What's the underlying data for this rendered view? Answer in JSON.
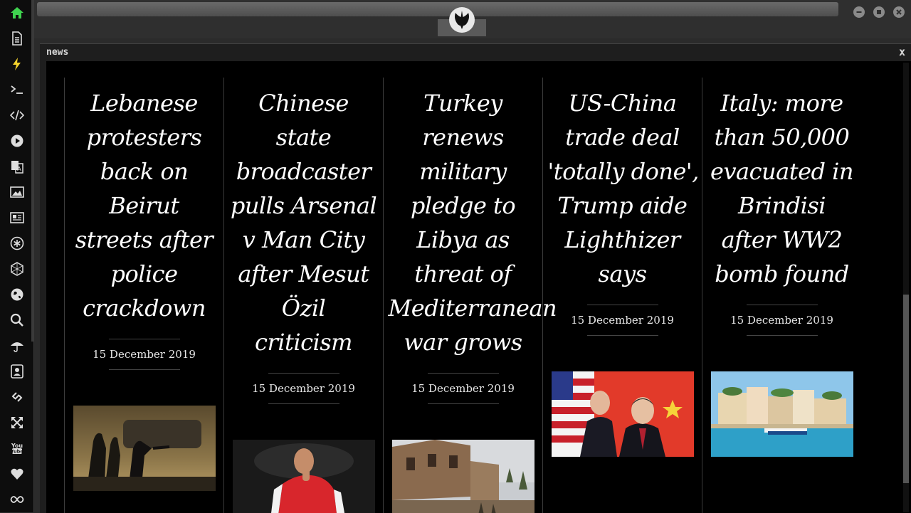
{
  "app": {
    "panel_title": "news",
    "close_label": "x"
  },
  "sidebar": {
    "items": [
      {
        "icon": "home-icon",
        "active": true
      },
      {
        "icon": "document-icon"
      },
      {
        "icon": "lightning-icon"
      },
      {
        "icon": "terminal-icon"
      },
      {
        "icon": "code-icon"
      },
      {
        "icon": "play-icon"
      },
      {
        "icon": "translate-icon"
      },
      {
        "icon": "image-icon"
      },
      {
        "icon": "news-icon"
      },
      {
        "icon": "asterisk-icon"
      },
      {
        "icon": "hexagon-icon"
      },
      {
        "icon": "globe-icon"
      },
      {
        "icon": "search-icon"
      },
      {
        "icon": "umbrella-icon"
      },
      {
        "icon": "contact-icon"
      },
      {
        "icon": "link-icon"
      },
      {
        "icon": "expand-icon"
      },
      {
        "icon": "youtube-icon"
      },
      {
        "icon": "heart-icon"
      },
      {
        "icon": "infinity-icon"
      }
    ]
  },
  "colors": {
    "accent_green": "#3fd34f",
    "accent_yellow": "#f2d12c"
  },
  "articles": [
    {
      "headline_lines": [
        "Lebanese",
        "protesters",
        "back on",
        "Beirut",
        "streets after",
        "police",
        "crackdown"
      ],
      "date": "15 December 2019",
      "image": "protest-night-photo"
    },
    {
      "headline_lines": [
        "Chinese",
        "state",
        "broadcaster",
        "pulls Arsenal",
        "v Man City",
        "after Mesut",
        "Özil",
        "criticism"
      ],
      "date": "15 December 2019",
      "image": "football-player-photo"
    },
    {
      "headline_lines": [
        "Turkey",
        "renews",
        "military",
        "pledge to",
        "Libya as",
        "threat of",
        "Mediterranean",
        "war grows"
      ],
      "date": "15 December 2019",
      "image": "ruined-buildings-photo"
    },
    {
      "headline_lines": [
        "US-China",
        "trade deal",
        "'totally done',",
        "Trump aide",
        "Lighthizer",
        "says"
      ],
      "date": "15 December 2019",
      "image": "trade-officials-photo"
    },
    {
      "headline_lines": [
        "Italy: more",
        "than 50,000",
        "evacuated in",
        "Brindisi",
        "after WW2",
        "bomb found"
      ],
      "date": "15 December 2019",
      "image": "harbor-town-photo"
    }
  ]
}
